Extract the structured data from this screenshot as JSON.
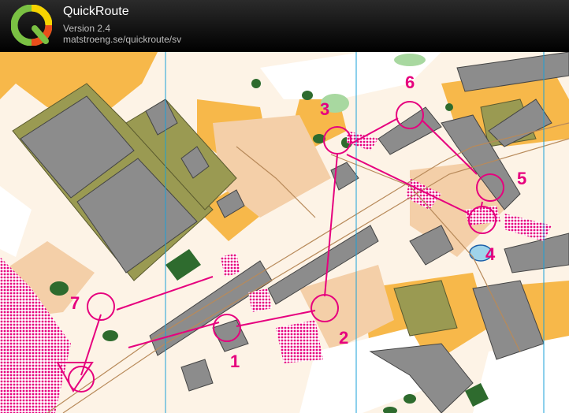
{
  "header": {
    "title": "QuickRoute",
    "version": "Version 2.4",
    "url": "matstroeng.se/quickroute/sv"
  },
  "logo": {
    "letter": "Q"
  },
  "map": {
    "controls": [
      {
        "label": "7"
      },
      {
        "label": "1"
      },
      {
        "label": "2"
      },
      {
        "label": "3"
      },
      {
        "label": "4"
      },
      {
        "label": "5"
      },
      {
        "label": "6"
      }
    ],
    "colors": {
      "course": "#e6007e",
      "paved": "#f4cfa8",
      "open": "#f7b84a",
      "building": "#8c8c8c",
      "olive": "#9a9a52",
      "forest": "#ffffff",
      "green": "#2e6b2e",
      "water": "#9fd3ea",
      "north_line": "#1aa0d8"
    }
  }
}
